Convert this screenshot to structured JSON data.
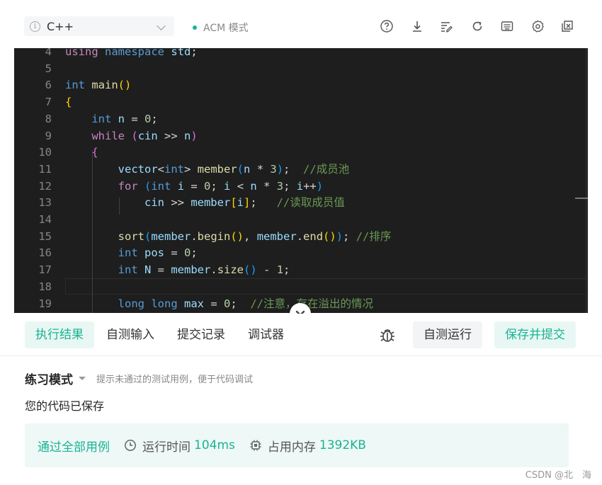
{
  "toolbar": {
    "language": "C++",
    "info_symbol": "i",
    "mode_label": "ACM 模式",
    "icons": [
      "help-icon",
      "download-icon",
      "format-icon",
      "reset-icon",
      "shortcut-icon",
      "settings-icon",
      "fullscreen-exit-icon"
    ]
  },
  "editor": {
    "lines": [
      {
        "n": "4",
        "html": "<span class=\"c\">using</span> <span class=\"k\">namespace</span> <span class=\"v\">std</span>;"
      },
      {
        "n": "5",
        "html": ""
      },
      {
        "n": "6",
        "html": "<span class=\"k\">int</span> <span class=\"f\">main</span><span class=\"p1\">()</span>"
      },
      {
        "n": "7",
        "html": "<span class=\"p1\">{</span>"
      },
      {
        "n": "8",
        "html": "    <span class=\"k\">int</span> <span class=\"v\">n</span> = <span class=\"n\">0</span>;"
      },
      {
        "n": "9",
        "html": "    <span class=\"c\">while</span> <span class=\"p2\">(</span><span class=\"v\">cin</span> &gt;&gt; <span class=\"v\">n</span><span class=\"p2\">)</span>"
      },
      {
        "n": "10",
        "html": "    <span class=\"p2\">{</span>"
      },
      {
        "n": "11",
        "html": "        <span class=\"v\">vector</span>&lt;<span class=\"k\">int</span>&gt; <span class=\"f\">member</span><span class=\"p3\">(</span><span class=\"v\">n</span> * <span class=\"n\">3</span><span class=\"p3\">)</span>;  <span class=\"cm\">//成员池</span>"
      },
      {
        "n": "12",
        "html": "        <span class=\"c\">for</span> <span class=\"p3\">(</span><span class=\"k\">int</span> <span class=\"v\">i</span> = <span class=\"n\">0</span>; <span class=\"v\">i</span> &lt; <span class=\"v\">n</span> * <span class=\"n\">3</span>; <span class=\"v\">i</span>++<span class=\"p3\">)</span>"
      },
      {
        "n": "13",
        "html": "            <span class=\"v\">cin</span> &gt;&gt; <span class=\"v\">member</span><span class=\"p1\">[</span><span class=\"v\">i</span><span class=\"p1\">]</span>;   <span class=\"cm\">//读取成员值</span>"
      },
      {
        "n": "14",
        "html": ""
      },
      {
        "n": "15",
        "html": "        <span class=\"f\">sort</span><span class=\"p3\">(</span><span class=\"v\">member</span>.<span class=\"f\">begin</span><span class=\"p1\">()</span>, <span class=\"v\">member</span>.<span class=\"f\">end</span><span class=\"p1\">()</span><span class=\"p3\">)</span>; <span class=\"cm\">//排序</span>"
      },
      {
        "n": "16",
        "html": "        <span class=\"k\">int</span> <span class=\"v\">pos</span> = <span class=\"n\">0</span>;"
      },
      {
        "n": "17",
        "html": "        <span class=\"k\">int</span> <span class=\"v\">N</span> = <span class=\"v\">member</span>.<span class=\"f\">size</span><span class=\"p3\">()</span> - <span class=\"n\">1</span>;"
      },
      {
        "n": "18",
        "html": ""
      },
      {
        "n": "19",
        "html": "        <span class=\"k\">long</span> <span class=\"k\">long</span> <span class=\"v\">max</span> = <span class=\"n\">0</span>;  <span class=\"cm\">//注意，存在溢出的情况</span>"
      }
    ]
  },
  "tabs": {
    "result": "执行结果",
    "custom_input": "自测输入",
    "history": "提交记录",
    "debugger": "调试器"
  },
  "actions": {
    "run": "自测运行",
    "submit": "保存并提交"
  },
  "panel": {
    "mode_title": "练习模式",
    "mode_hint": "提示未通过的测试用例，便于代码调试",
    "saved_msg": "您的代码已保存",
    "pass_label": "通过全部用例",
    "time_label": "运行时间",
    "time_value": "104ms",
    "mem_label": "占用内存",
    "mem_value": "1392KB"
  },
  "watermark": "CSDN @北　海",
  "colors": {
    "accent": "#1ab394",
    "editor_bg": "#1e1e1e"
  }
}
